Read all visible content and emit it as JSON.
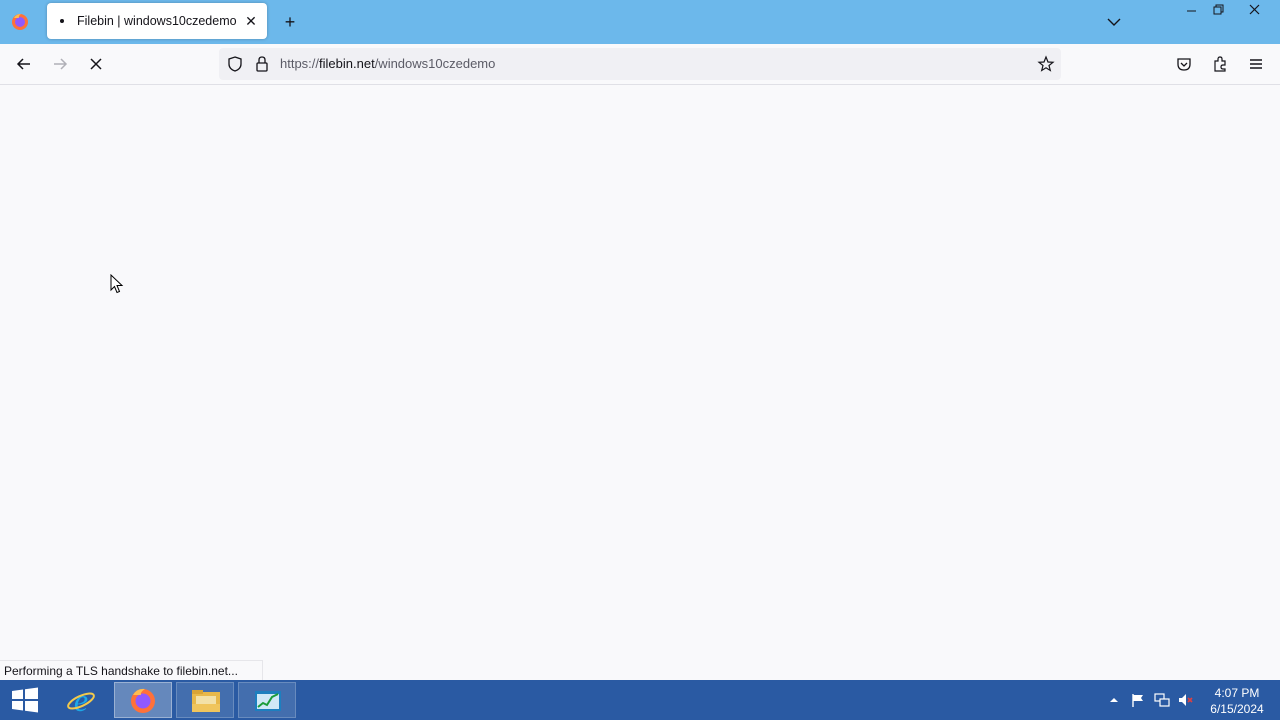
{
  "browser": {
    "tab": {
      "title": "Filebin | windows10czedemo"
    },
    "url": {
      "scheme": "https://",
      "host": "filebin.net",
      "path": "/windows10czedemo"
    },
    "status_text": "Performing a TLS handshake to filebin.net...",
    "loading": true
  },
  "icons": {
    "app": "firefox-icon",
    "new_tab": "plus-icon",
    "tab_list": "chevron-down-icon",
    "back": "back-arrow-icon",
    "forward": "forward-arrow-icon",
    "stop": "stop-icon",
    "tracking": "shield-icon",
    "lock": "lock-icon",
    "bookmark": "star-icon",
    "pocket": "pocket-icon",
    "extensions": "puzzle-icon",
    "menu": "hamburger-icon"
  },
  "taskbar": {
    "apps": [
      "start",
      "internet-explorer",
      "firefox",
      "file-explorer",
      "task-manager"
    ],
    "clock": {
      "time": "4:07 PM",
      "date": "6/15/2024"
    }
  },
  "colors": {
    "titlebar": "#6cb8eb",
    "taskbar": "#2a5aa3",
    "content_bg": "#f9f9fb"
  }
}
